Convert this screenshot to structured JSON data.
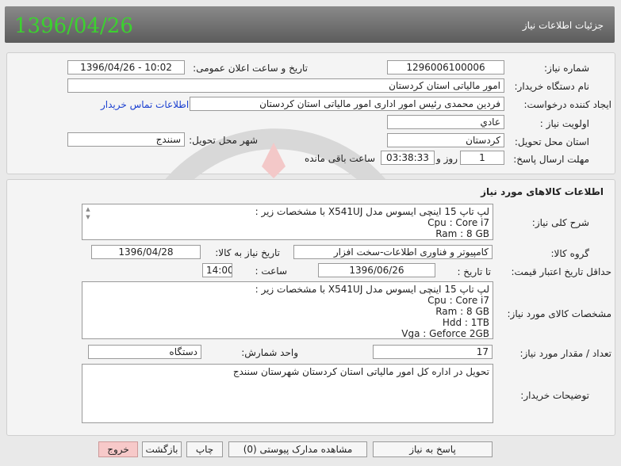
{
  "header": {
    "date": "1396/04/26",
    "title": "جزئیات اطلاعات نیاز"
  },
  "info": {
    "need_number_label": "شماره نیاز:",
    "need_number": "1296006100006",
    "announce_label": "تاریخ و ساعت اعلان عمومی:",
    "announce_value": "1396/04/26 - 10:02",
    "buyer_org_label": "نام دستگاه خریدار:",
    "buyer_org": "امور مالیاتی استان کردستان",
    "creator_label": "ایجاد کننده درخواست:",
    "creator": "فردین محمدی رئیس امور اداری امور مالیاتی استان کردستان",
    "contact_link": "اطلاعات تماس خریدار",
    "priority_label": "اولویت نیاز :",
    "priority": "عادي",
    "province_label": "استان محل تحویل:",
    "province": "کردستان",
    "city_label": "شهر محل تحویل:",
    "city": "سنندج",
    "deadline_label": "مهلت ارسال پاسخ:",
    "deadline_days": "1",
    "days_word": "روز و",
    "deadline_time": "03:38:33",
    "remaining_word": "ساعت باقی مانده"
  },
  "goods": {
    "section_title": "اطلاعات کالاهای مورد نیاز",
    "summary_label": "شرح کلی نیاز:",
    "summary_lines": [
      "لپ تاپ 15 اینچی ایسوس مدل X541UJ  با مشخصات زیر :",
      "Cpu : Core i7",
      "Ram : 8 GB"
    ],
    "group_label": "گروه کالا:",
    "group": "کامپیوتر و فناوری اطلاعات-سخت افزار",
    "need_date_label": "تاریخ نیاز به کالا:",
    "need_date": "1396/04/28",
    "min_price_label": "حداقل تاریخ اعتبار قیمت:",
    "to_date_label": "تا تاریخ :",
    "to_date": "1396/06/26",
    "time_label": "ساعت :",
    "time": "14:00",
    "specs_label": "مشخصات کالای مورد نیاز:",
    "specs_lines": [
      "لپ تاپ 15 اینچی ایسوس مدل X541UJ  با مشخصات زیر :",
      "Cpu : Core i7",
      "Ram : 8 GB",
      "Hdd : 1TB",
      "Vga : Geforce 2GB"
    ],
    "qty_label": "تعداد / مقدار مورد نیاز:",
    "qty": "17",
    "unit_label": "واحد شمارش:",
    "unit": "دستگاه",
    "desc_label": "توضیحات خریدار:",
    "desc": "تحویل در اداره کل امور مالیاتی استان کردستان شهرستان سنندج"
  },
  "buttons": {
    "reply": "پاسخ به نیاز",
    "attachments": "مشاهده مدارک پیوستی (0)",
    "print": "چاپ",
    "back": "بازگشت",
    "exit": "خروج"
  },
  "colors": {
    "header_date": "#3bd22f",
    "link": "#1a3fd0",
    "exit_bg": "#f7c9c9"
  }
}
